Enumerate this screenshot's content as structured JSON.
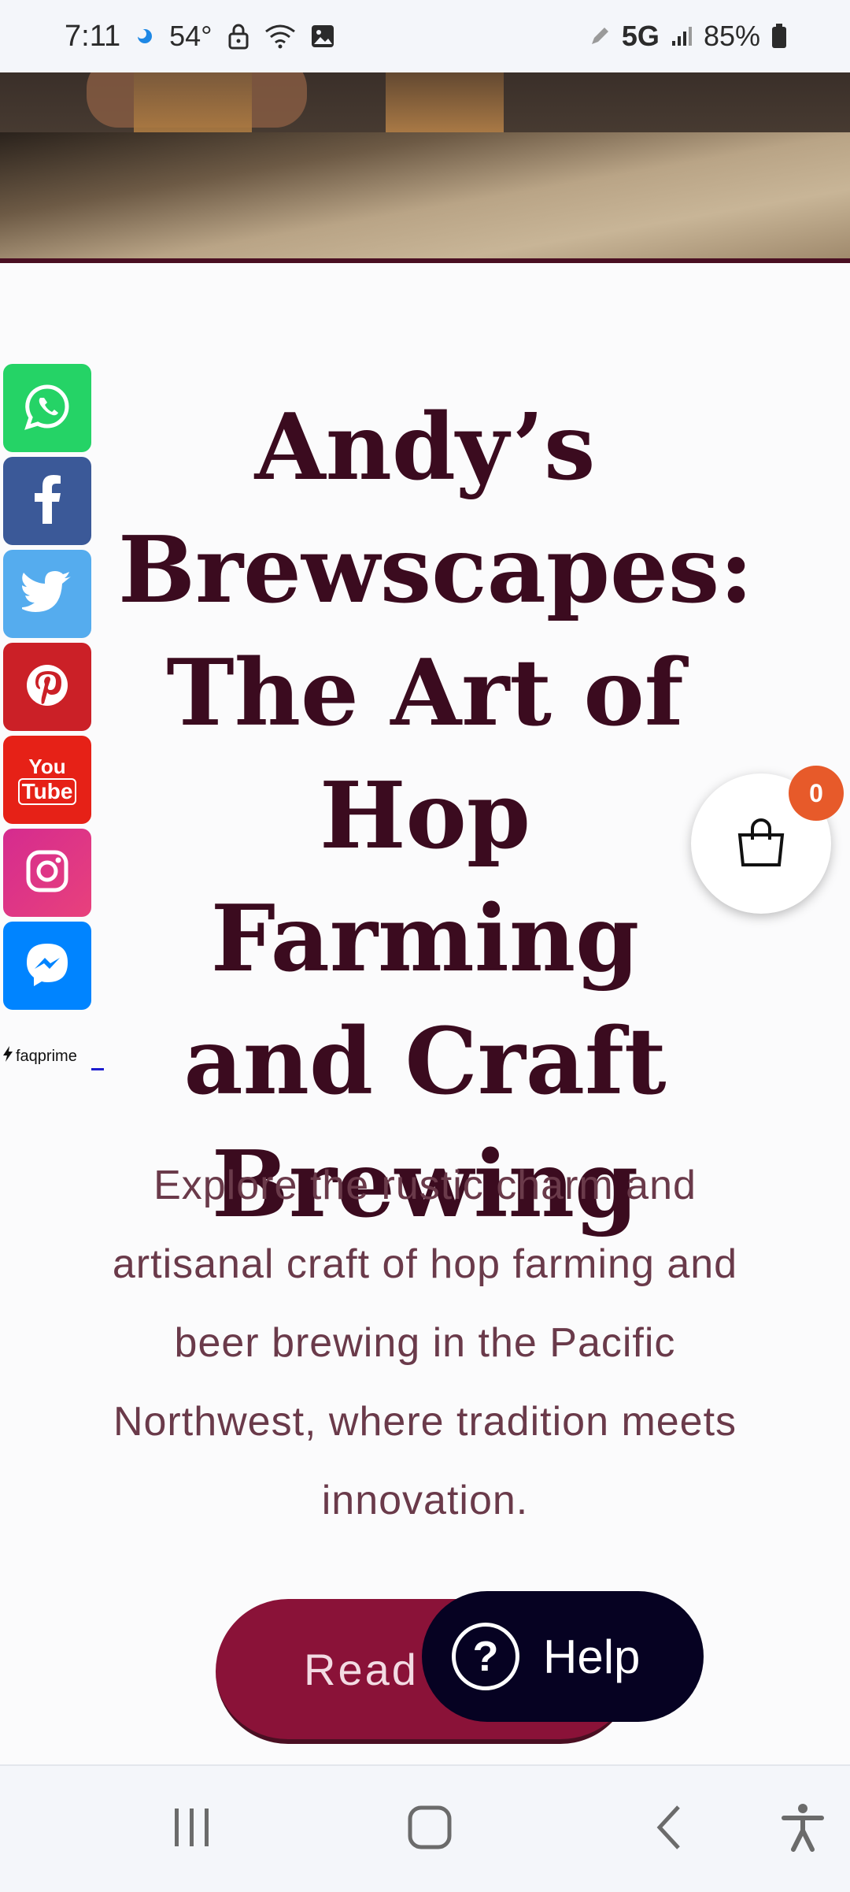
{
  "status_bar": {
    "time": "7:11",
    "temperature": "54°",
    "network": "5G",
    "battery": "85%",
    "icons": [
      "weather-icon",
      "lock-icon",
      "wifi-icon",
      "gallery-icon",
      "pen-icon",
      "signal-icon",
      "battery-icon"
    ]
  },
  "hero": {
    "image": "beer-glasses-on-wooden-table"
  },
  "social": {
    "items": [
      {
        "name": "WhatsApp",
        "icon": "whatsapp-icon",
        "color": "#25d366"
      },
      {
        "name": "Facebook",
        "icon": "facebook-icon",
        "color": "#3b5998"
      },
      {
        "name": "Twitter",
        "icon": "twitter-icon",
        "color": "#55acee"
      },
      {
        "name": "Pinterest",
        "icon": "pinterest-icon",
        "color": "#cb2027"
      },
      {
        "name": "YouTube",
        "icon": "youtube-icon",
        "color": "#e62117",
        "text_top": "You",
        "text_bottom": "Tube"
      },
      {
        "name": "Instagram",
        "icon": "instagram-icon",
        "color": "#e4405f"
      },
      {
        "name": "Messenger",
        "icon": "messenger-icon",
        "color": "#0084ff"
      }
    ]
  },
  "faqprime": {
    "label": "faqprime"
  },
  "main": {
    "title": "Andy’s Brewscapes: The Art of Hop Farming and Craft Brewing",
    "subtitle": "Explore the rustic charm and artisanal craft of hop farming and beer brewing in the Pacific Northwest, where tradition meets innovation.",
    "read_button": "Read"
  },
  "cart": {
    "count": "0",
    "icon": "shopping-bag-icon"
  },
  "help": {
    "label": "Help",
    "icon": "question-icon"
  },
  "colors": {
    "title": "#3b0b1f",
    "subtitle": "#6a3a4a",
    "button": "#8a1238",
    "help": "#060222",
    "badge": "#e75a2a"
  },
  "nav_bar": {
    "icons": [
      "recent-apps-icon",
      "home-icon",
      "back-icon",
      "accessibility-icon"
    ]
  }
}
